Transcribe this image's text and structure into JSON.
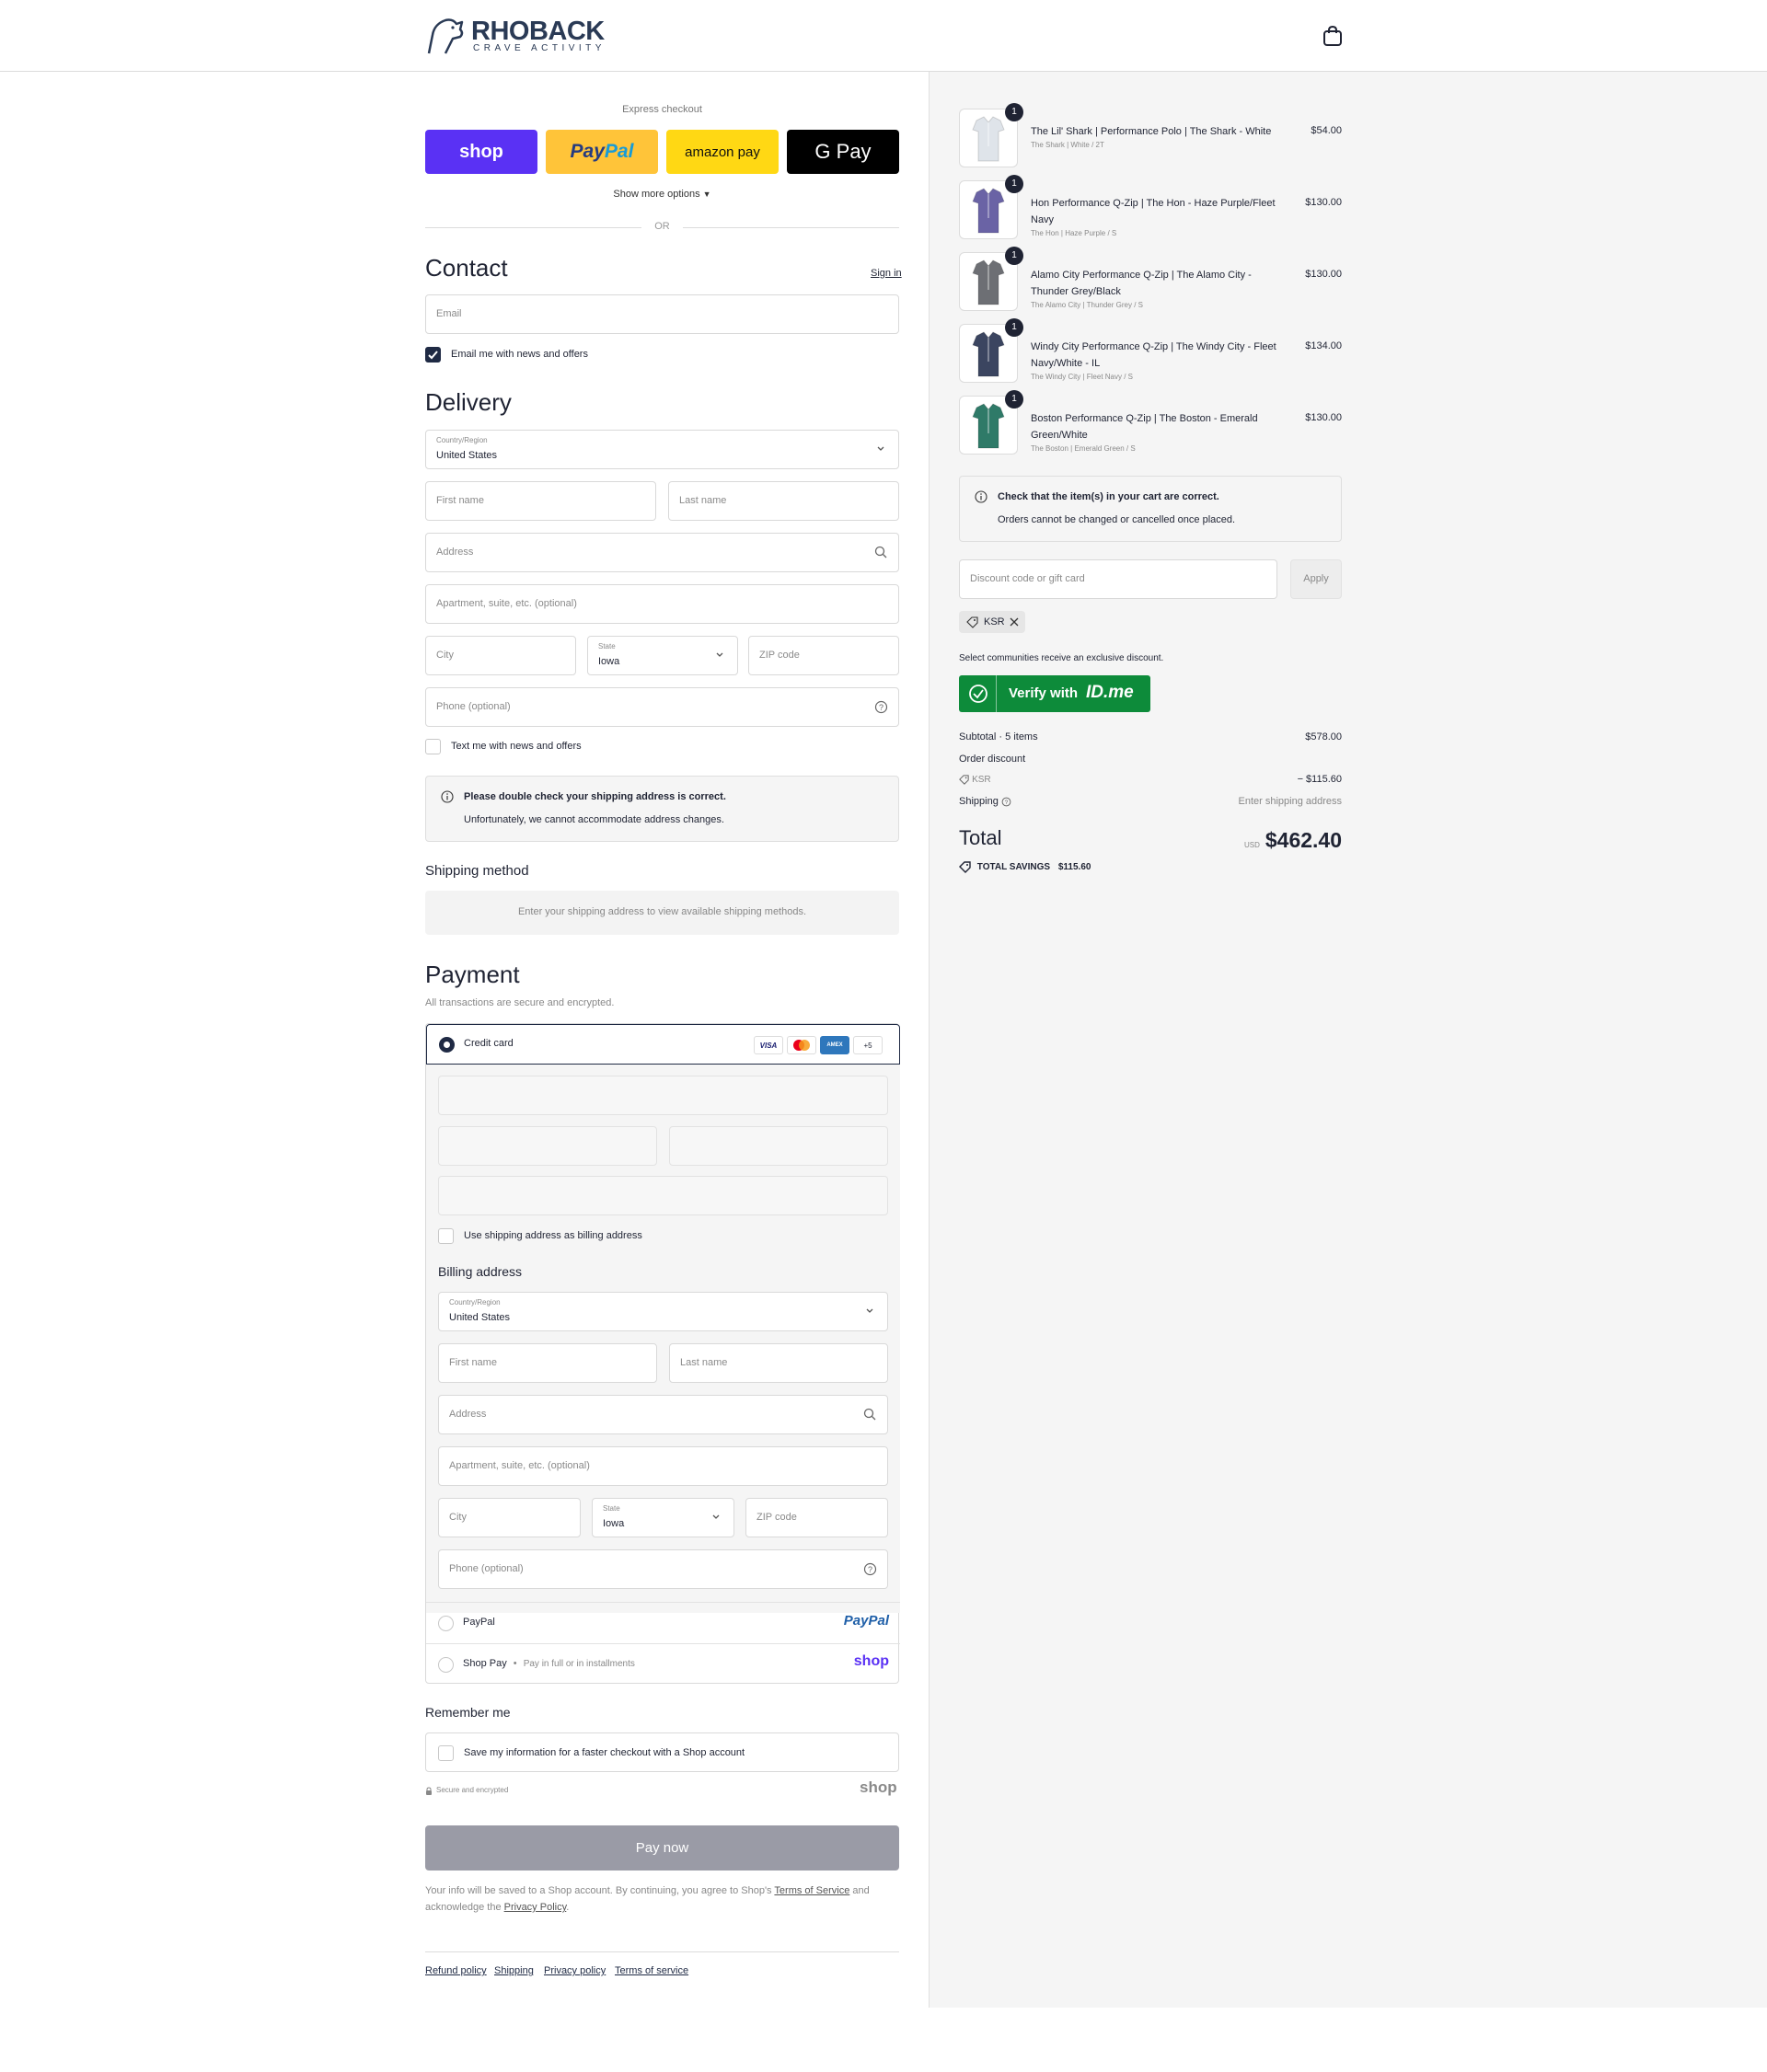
{
  "header": {
    "brand": "RHOBACK",
    "tagline": "CRAVE ACTIVITY"
  },
  "express": {
    "label": "Express checkout",
    "buttons": [
      "shop",
      "PayPal",
      "amazon pay",
      "G Pay"
    ],
    "show_more": "Show more options",
    "or": "OR"
  },
  "contact": {
    "title": "Contact",
    "sign_in": "Sign in",
    "email_placeholder": "Email",
    "news_label": "Email me with news and offers"
  },
  "delivery": {
    "title": "Delivery",
    "country_label": "Country/Region",
    "country": "United States",
    "first_name": "First name",
    "last_name": "Last name",
    "address": "Address",
    "apartment": "Apartment, suite, etc. (optional)",
    "city": "City",
    "state_label": "State",
    "state": "Iowa",
    "zip": "ZIP code",
    "phone": "Phone (optional)",
    "text_label": "Text me with news and offers",
    "notice_title": "Please double check your shipping address is correct.",
    "notice_body": "Unfortunately, we cannot accommodate address changes."
  },
  "shipping": {
    "title": "Shipping method",
    "message": "Enter your shipping address to view available shipping methods."
  },
  "payment": {
    "title": "Payment",
    "subtitle": "All transactions are secure and encrypted.",
    "credit_card": "Credit card",
    "cards": [
      "VISA",
      "MC",
      "AMEX",
      "+5"
    ],
    "use_shipping": "Use shipping address as billing address",
    "billing_title": "Billing address",
    "paypal": "PayPal",
    "paypal_logo": "PayPal",
    "shop_pay": "Shop Pay",
    "shop_pay_note": "Pay in full or in installments",
    "shop_logo": "shop"
  },
  "remember": {
    "title": "Remember me",
    "save_label": "Save my information for a faster checkout with a Shop account",
    "secure": "Secure and encrypted",
    "shop_logo": "shop"
  },
  "pay_now": "Pay now",
  "legal": {
    "text1": "Your info will be saved to a Shop account. By continuing, you agree to Shop's",
    "tos": "Terms of Service",
    "text2": "and acknowledge the",
    "privacy": "Privacy Policy",
    "end": "."
  },
  "footer_links": [
    "Refund policy",
    "Shipping",
    "Privacy policy",
    "Terms of service"
  ],
  "cart": {
    "items": [
      {
        "qty": "1",
        "title": "The Lil' Shark | Performance Polo | The Shark - White",
        "variant": "The Shark | White / 2T",
        "price": "$54.00",
        "color": "#dfe4ea"
      },
      {
        "qty": "1",
        "title": "Hon Performance Q-Zip | The Hon - Haze Purple/Fleet Navy",
        "variant": "The Hon | Haze Purple / S",
        "price": "$130.00",
        "color": "#6a63a5"
      },
      {
        "qty": "1",
        "title": "Alamo City Performance Q-Zip | The Alamo City - Thunder Grey/Black",
        "variant": "The Alamo City | Thunder Grey / S",
        "price": "$130.00",
        "color": "#6d6f74"
      },
      {
        "qty": "1",
        "title": "Windy City Performance Q-Zip | The Windy City - Fleet Navy/White - IL",
        "variant": "The Windy City | Fleet Navy / S",
        "price": "$134.00",
        "color": "#3b4560"
      },
      {
        "qty": "1",
        "title": "Boston Performance Q-Zip | The Boston - Emerald Green/White",
        "variant": "The Boston | Emerald Green / S",
        "price": "$130.00",
        "color": "#2f7a68"
      }
    ],
    "notice_title": "Check that the item(s) in your cart are correct.",
    "notice_body": "Orders cannot be changed or cancelled once placed.",
    "discount_placeholder": "Discount code or gift card",
    "apply": "Apply",
    "code": "KSR",
    "communities": "Select communities receive an exclusive discount.",
    "idme_label": "Verify with",
    "idme_logo": "ID.me",
    "subtotal_label": "Subtotal · 5 items",
    "subtotal": "$578.00",
    "order_discount": "Order discount",
    "discount_code": "KSR",
    "discount_amount": "− $115.60",
    "shipping_label": "Shipping",
    "shipping_value": "Enter shipping address",
    "total_label": "Total",
    "currency": "USD",
    "total": "$462.40",
    "savings_label": "TOTAL SAVINGS",
    "savings": "$115.60"
  },
  "colors": {
    "accent": "#1f2a44",
    "shop": "#5a31f4",
    "paypal": "#ffc439",
    "amazon": "#ffd814",
    "idme": "#0d8b3a"
  }
}
